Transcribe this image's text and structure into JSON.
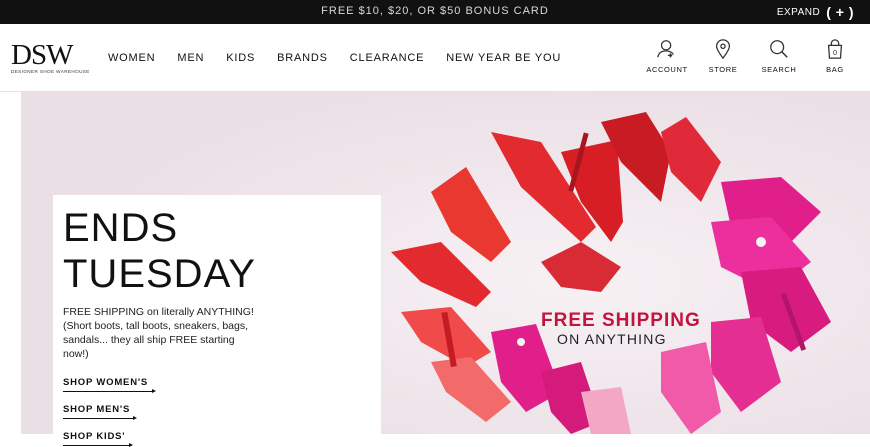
{
  "promo_bar": {
    "text": "FREE $10, $20, OR $50 BONUS CARD",
    "expand_label": "EXPAND"
  },
  "header": {
    "logo_text": "DSW",
    "logo_tagline": "DESIGNER SHOE WAREHOUSE",
    "nav": [
      "WOMEN",
      "MEN",
      "KIDS",
      "BRANDS",
      "CLEARANCE",
      "NEW YEAR BE YOU"
    ],
    "utility": [
      {
        "label": "ACCOUNT",
        "icon": "account-icon"
      },
      {
        "label": "STORE",
        "icon": "map-pin-icon"
      },
      {
        "label": "SEARCH",
        "icon": "search-icon"
      },
      {
        "label": "BAG",
        "icon": "bag-icon",
        "count": "0"
      }
    ]
  },
  "hero": {
    "headline": "ENDS TUESDAY",
    "body": "FREE SHIPPING on literally ANYTHING! (Short boots, tall boots, sneakers, bags, sandals... they all ship FREE starting now!)",
    "links": [
      "SHOP WOMEN'S",
      "SHOP MEN'S",
      "SHOP KIDS'"
    ],
    "overlay_title": "FREE SHIPPING",
    "overlay_subtitle": "ON ANYTHING"
  },
  "colors": {
    "top_bar": "#111111",
    "hero_background": "#f0e8ed",
    "accent": "#c2143d",
    "shoe_red": "#e32a2f",
    "shoe_pink": "#e11f8a"
  }
}
